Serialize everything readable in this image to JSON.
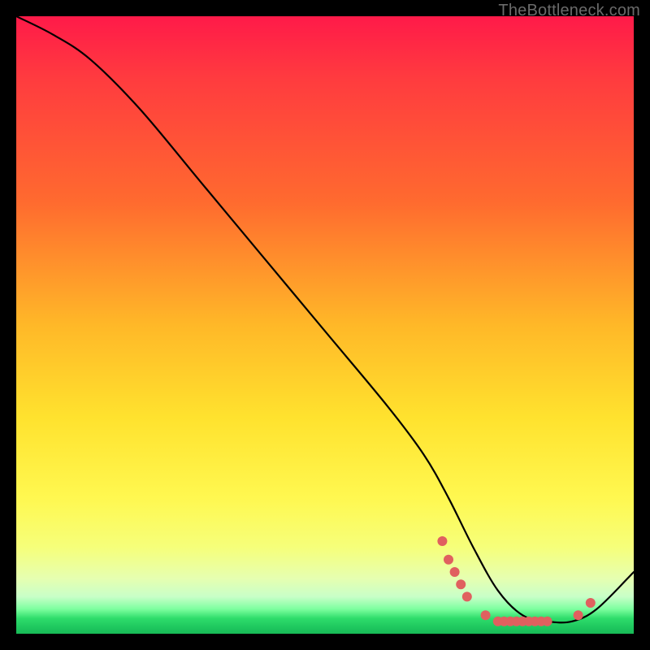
{
  "watermark": "TheBottleneck.com",
  "chart_data": {
    "type": "line",
    "title": "",
    "xlabel": "",
    "ylabel": "",
    "xlim": [
      0,
      100
    ],
    "ylim": [
      0,
      100
    ],
    "series": [
      {
        "name": "curve",
        "x": [
          0,
          6,
          12,
          20,
          30,
          40,
          50,
          60,
          66,
          70,
          74,
          78,
          82,
          86,
          90,
          94,
          100
        ],
        "y": [
          100,
          97,
          93,
          85,
          73,
          61,
          49,
          37,
          29,
          22,
          14,
          7,
          3,
          2,
          2,
          4,
          10
        ]
      }
    ],
    "markers": [
      {
        "x": 69,
        "y": 15
      },
      {
        "x": 70,
        "y": 12
      },
      {
        "x": 71,
        "y": 10
      },
      {
        "x": 72,
        "y": 8
      },
      {
        "x": 73,
        "y": 6
      },
      {
        "x": 76,
        "y": 3
      },
      {
        "x": 78,
        "y": 2
      },
      {
        "x": 79,
        "y": 2
      },
      {
        "x": 80,
        "y": 2
      },
      {
        "x": 81,
        "y": 2
      },
      {
        "x": 82,
        "y": 2
      },
      {
        "x": 83,
        "y": 2
      },
      {
        "x": 84,
        "y": 2
      },
      {
        "x": 85,
        "y": 2
      },
      {
        "x": 86,
        "y": 2
      },
      {
        "x": 91,
        "y": 3
      },
      {
        "x": 93,
        "y": 5
      }
    ],
    "marker_color": "#e0605f",
    "marker_radius_px": 6,
    "note": "No axis ticks or labels are visible; x is relative position, y is bottleneck percentage approximated from pixel height."
  }
}
